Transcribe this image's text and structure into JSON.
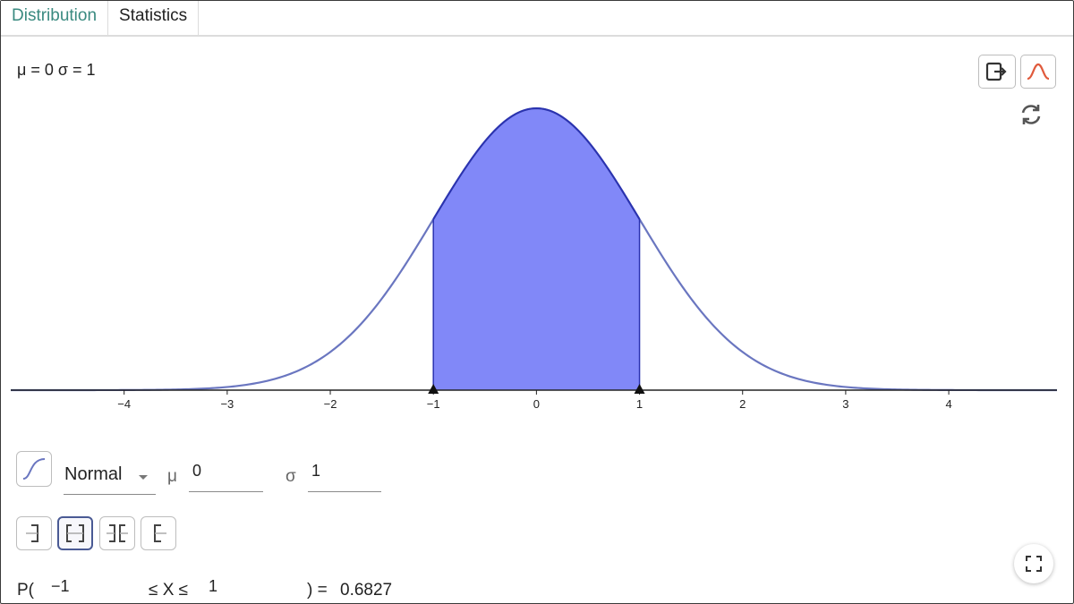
{
  "tabs": [
    {
      "label": "Distribution",
      "active": true
    },
    {
      "label": "Statistics",
      "active": false
    }
  ],
  "params_display": "μ = 0 σ = 1",
  "toolbar": {
    "export_icon": "export-icon",
    "overlay_normal_icon": "normal-curve-icon",
    "reset_icon": "refresh-icon"
  },
  "distribution": {
    "name": "Normal",
    "mu_label": "μ",
    "mu_value": "0",
    "sigma_label": "σ",
    "sigma_value": "1",
    "cumulative_icon": "cumulative-curve-icon"
  },
  "interval_types": [
    {
      "name": "left-sided",
      "selected": false
    },
    {
      "name": "interval",
      "selected": true
    },
    {
      "name": "two-tailed",
      "selected": false
    },
    {
      "name": "right-sided",
      "selected": false
    }
  ],
  "probability": {
    "prefix": "P(",
    "low": "−1",
    "middle": "≤ X ≤",
    "high": "1",
    "equals": ") =",
    "result": "0.6827"
  },
  "chart_data": {
    "type": "area",
    "title": "",
    "xlabel": "",
    "ylabel": "",
    "function": "normal pdf",
    "mu": 0,
    "sigma": 1,
    "xlim": [
      -5.1,
      5.05
    ],
    "ylim": [
      0,
      0.399
    ],
    "x_ticks": [
      -4,
      -3,
      -2,
      -1,
      0,
      1,
      2,
      3,
      4
    ],
    "x_tick_labels": [
      "−4",
      "−3",
      "−2",
      "−1",
      "0",
      "1",
      "2",
      "3",
      "4"
    ],
    "shaded_interval": [
      -1,
      1
    ],
    "markers": [
      -1,
      1
    ],
    "colors": {
      "curve": "#6a76c0",
      "shaded_fill": "#8188f8",
      "shaded_stroke": "#2a32b0",
      "axis": "#222222",
      "tab_active": "#3a8a80",
      "overlay_icon": "#e05a3c"
    }
  }
}
